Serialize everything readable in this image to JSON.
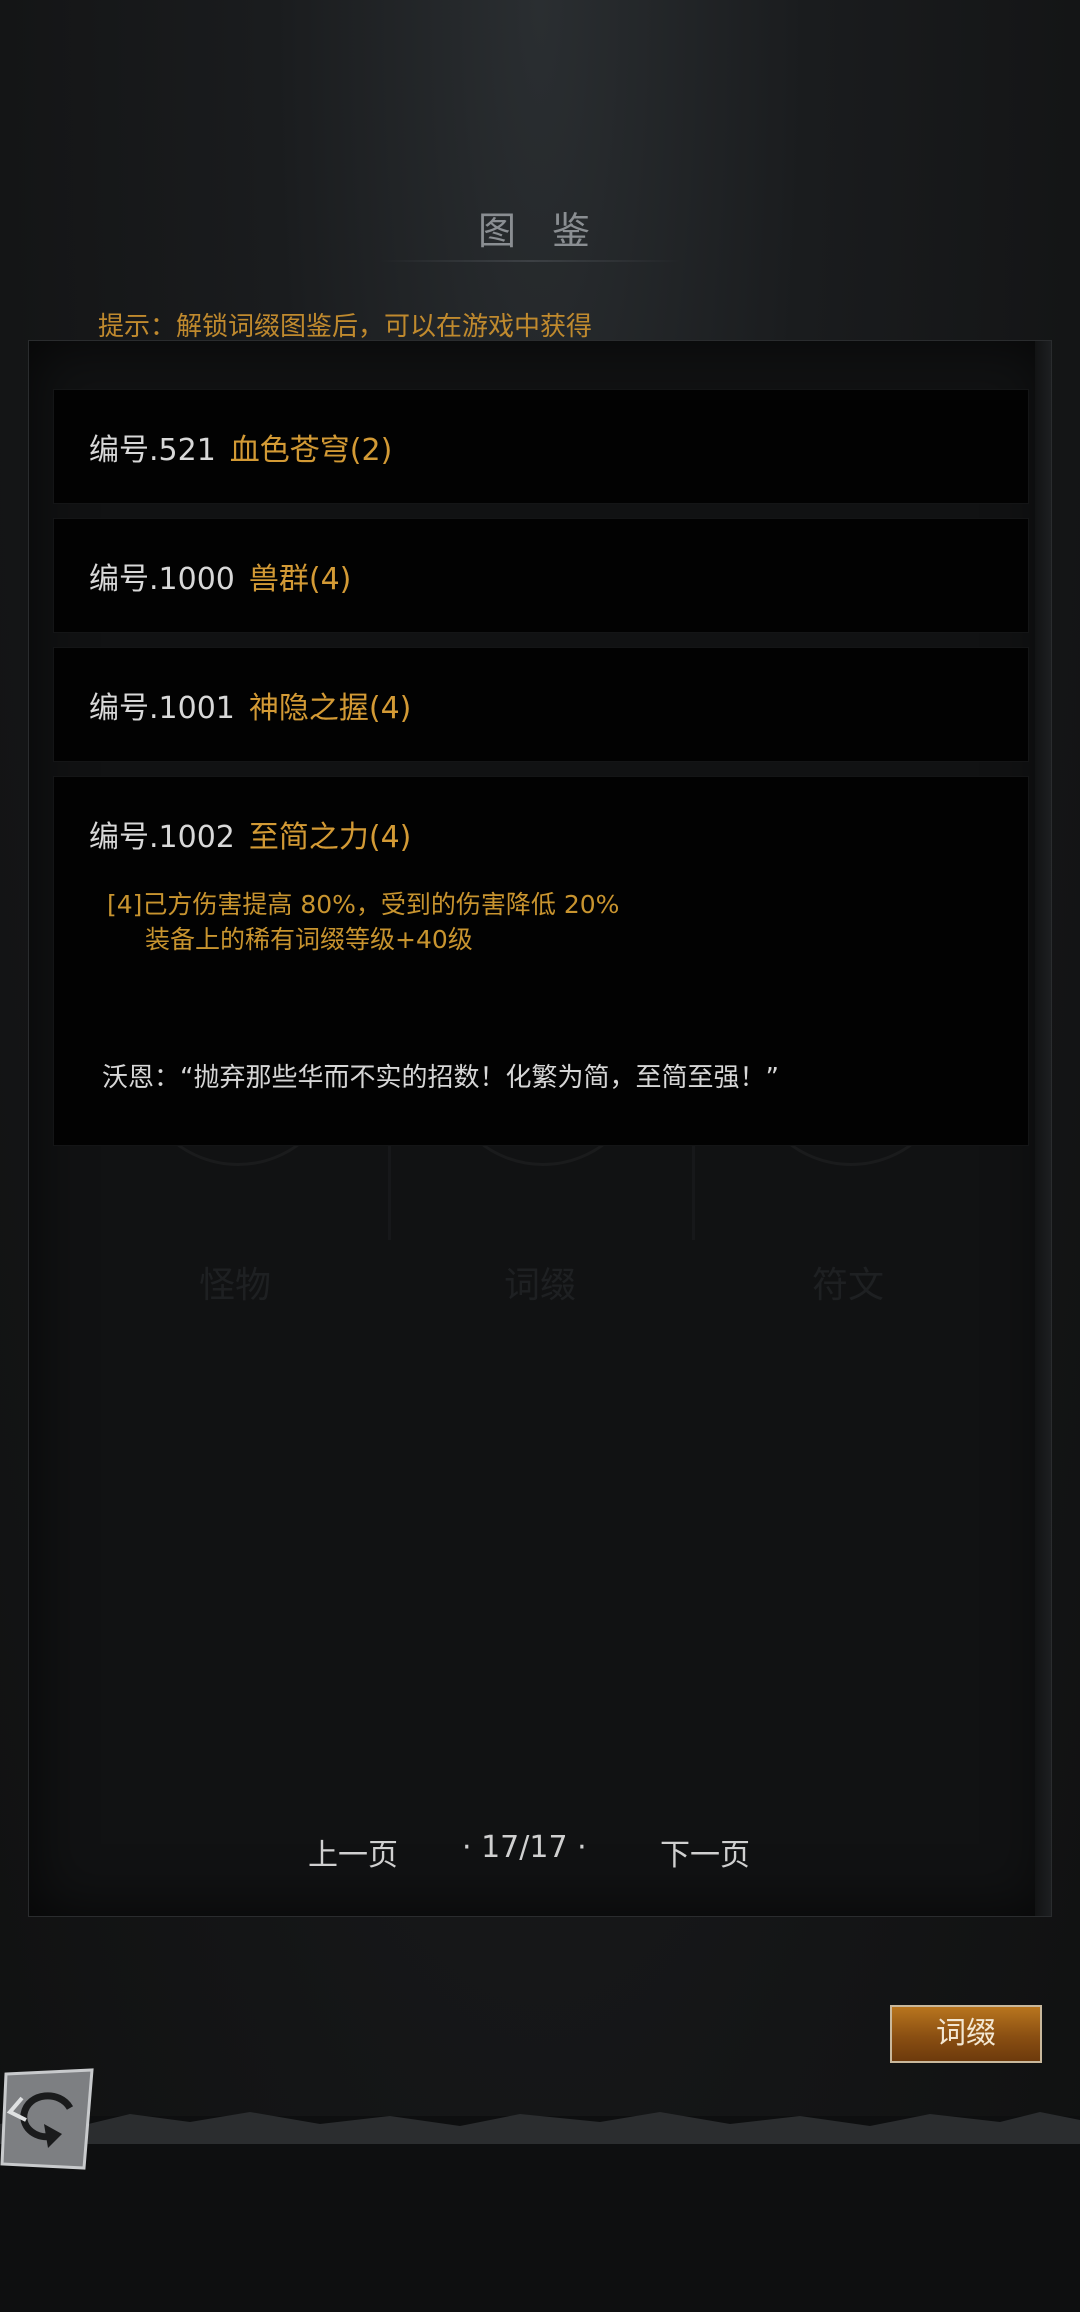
{
  "title": "图 鉴",
  "hint": "提示：解锁词缀图鉴后，可以在游戏中获得",
  "entries": [
    {
      "number": "编号.521",
      "name": "血色苍穹(2)"
    },
    {
      "number": "编号.1000",
      "name": "兽群(4)"
    },
    {
      "number": "编号.1001",
      "name": "神隐之握(4)"
    },
    {
      "number": "编号.1002",
      "name": "至简之力(4)"
    }
  ],
  "expanded": {
    "effect_line1": "[4]己方伤害提高 80%，受到的伤害降低 20%",
    "effect_line2": "装备上的稀有词缀等级+40级",
    "quote": "沃恩：“抛弃那些华而不实的招数！化繁为简，至简至强！”"
  },
  "categories": [
    "怪物",
    "词缀",
    "符文"
  ],
  "pager": {
    "prev": "上一页",
    "page": "· 17/17 ·",
    "next": "下一页"
  },
  "buttons": {
    "suffix": "词缀",
    "back_icon": "back-arrow-icon"
  },
  "colors": {
    "accent": "#d39a35",
    "hint": "#c08a2e",
    "button": "#8a4f12"
  }
}
